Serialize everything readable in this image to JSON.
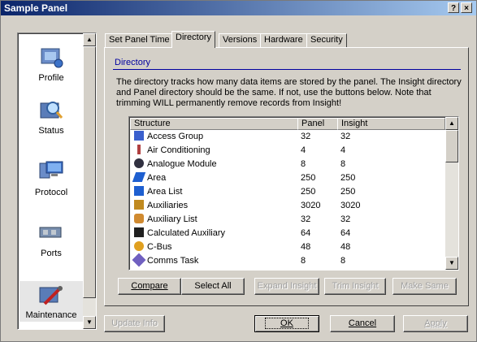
{
  "window": {
    "title": "Sample Panel",
    "help_label": "?",
    "close_label": "×"
  },
  "nav": {
    "items": [
      {
        "label": "Profile",
        "icon": "profile-icon"
      },
      {
        "label": "Status",
        "icon": "status-icon"
      },
      {
        "label": "Protocol",
        "icon": "protocol-icon"
      },
      {
        "label": "Ports",
        "icon": "ports-icon"
      },
      {
        "label": "Maintenance",
        "icon": "maintenance-icon",
        "selected": true
      }
    ]
  },
  "tabs": [
    {
      "label": "Set Panel Time"
    },
    {
      "label": "Directory",
      "active": true
    },
    {
      "label": "Versions"
    },
    {
      "label": "Hardware"
    },
    {
      "label": "Security"
    }
  ],
  "directory": {
    "section_title": "Directory",
    "description": "The directory tracks how many data items are stored by the panel. The Insight directory and Panel directory should be the same. If not, use the buttons below. Note that trimming WILL permanently remove records from Insight!",
    "columns": [
      "Structure",
      "Panel",
      "Insight"
    ],
    "rows": [
      {
        "structure": "Access Group",
        "panel": "32",
        "insight": "32",
        "icon": "access-group-icon",
        "color": "#3a5fcd"
      },
      {
        "structure": "Air Conditioning",
        "panel": "4",
        "insight": "4",
        "icon": "thermometer-icon",
        "color": "#b04040"
      },
      {
        "structure": "Analogue Module",
        "panel": "8",
        "insight": "8",
        "icon": "analogue-module-icon",
        "color": "#303040"
      },
      {
        "structure": "Area",
        "panel": "250",
        "insight": "250",
        "icon": "area-icon",
        "color": "#1e5fd0"
      },
      {
        "structure": "Area List",
        "panel": "250",
        "insight": "250",
        "icon": "area-list-icon",
        "color": "#1e5fd0"
      },
      {
        "structure": "Auxiliaries",
        "panel": "3020",
        "insight": "3020",
        "icon": "auxiliaries-icon",
        "color": "#c08a20"
      },
      {
        "structure": "Auxiliary List",
        "panel": "32",
        "insight": "32",
        "icon": "auxiliary-list-icon",
        "color": "#d08a30"
      },
      {
        "structure": "Calculated Auxiliary",
        "panel": "64",
        "insight": "64",
        "icon": "calculated-auxiliary-icon",
        "color": "#202020"
      },
      {
        "structure": "C-Bus",
        "panel": "48",
        "insight": "48",
        "icon": "c-bus-icon",
        "color": "#e0a020"
      },
      {
        "structure": "Comms Task",
        "panel": "8",
        "insight": "8",
        "icon": "comms-task-icon",
        "color": "#7060c0"
      }
    ]
  },
  "actions": {
    "compare": "Compare",
    "select_all": "Select All",
    "expand_insight": "Expand Insight",
    "trim_insight": "Trim Insight",
    "make_same": "Make Same"
  },
  "footer": {
    "update_info": "Update Info",
    "ok": "OK",
    "cancel": "Cancel",
    "apply": "Apply"
  }
}
